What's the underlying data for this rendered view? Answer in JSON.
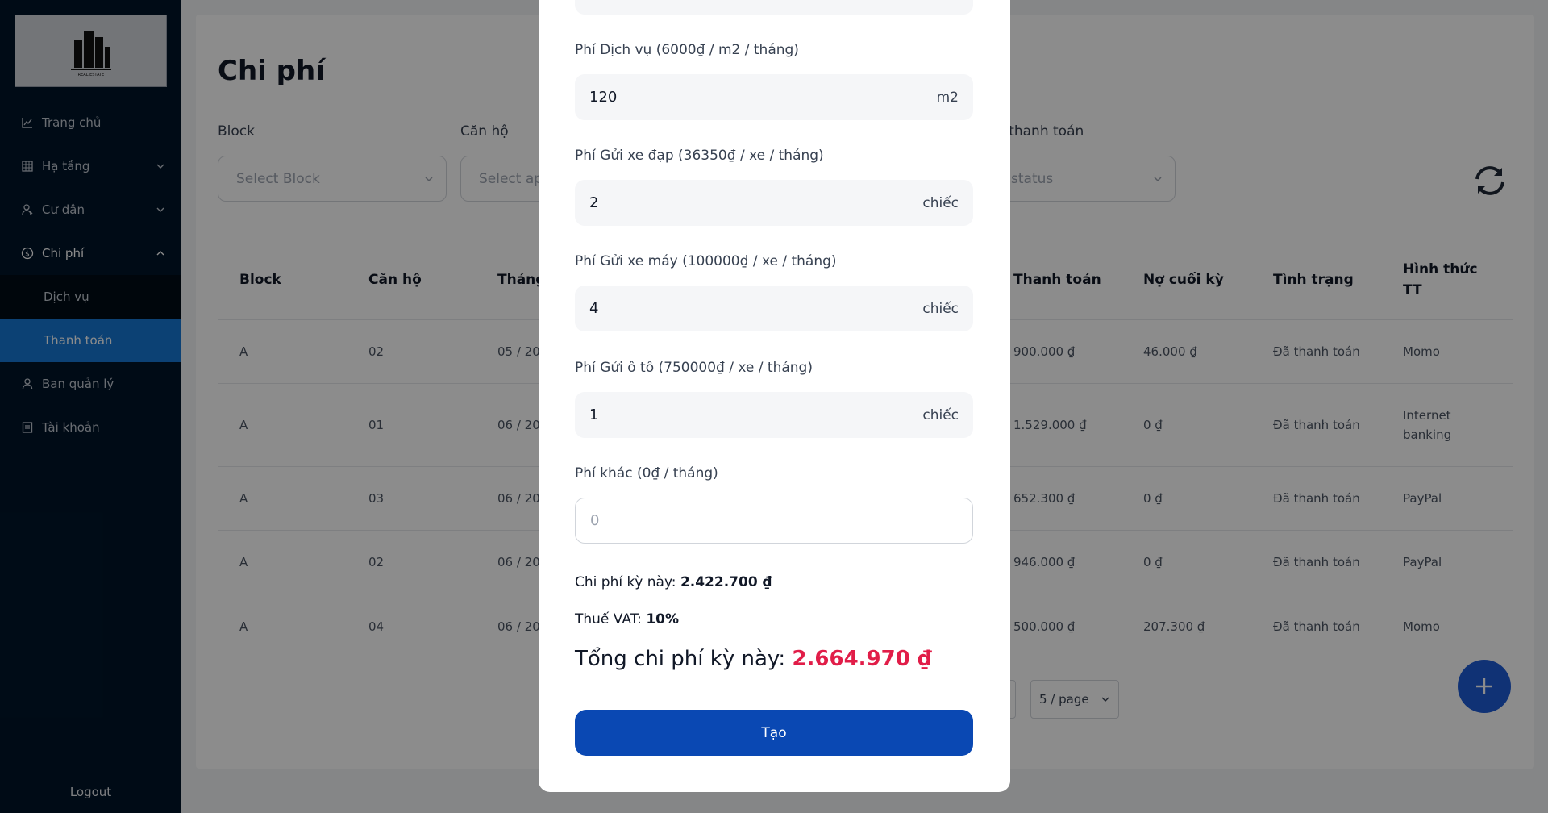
{
  "sidebar": {
    "logo_text": "REAL ESTATE",
    "items": [
      {
        "label": "Trang chủ",
        "icon": "line-chart-icon"
      },
      {
        "label": "Hạ tầng",
        "icon": "building-grid-icon"
      },
      {
        "label": "Cư dân",
        "icon": "team-icon"
      },
      {
        "label": "Chi phí",
        "icon": "dollar-circle-icon"
      },
      {
        "label": "Dịch vụ"
      },
      {
        "label": "Thanh toán"
      },
      {
        "label": "Ban quản lý",
        "icon": "user-icon"
      },
      {
        "label": "Tài khoản",
        "icon": "account-book-icon"
      }
    ],
    "logout": "Logout"
  },
  "page": {
    "title": "Chi phí",
    "filters": {
      "block_label": "Block",
      "block_placeholder": "Select Block",
      "apartment_label": "Căn hộ",
      "apartment_placeholder": "Select ap",
      "status_label": "g thanh toán",
      "status_placeholder": "status"
    }
  },
  "table": {
    "headers": [
      "Block",
      "Căn hộ",
      "Tháng",
      "Thanh toán",
      "Nợ cuối kỳ",
      "Tình trạng",
      "Hình thức TT"
    ],
    "rows": [
      {
        "block": "A",
        "apt": "02",
        "month": "05 / 20",
        "paid": "900.000 ₫",
        "debt": "46.000 ₫",
        "status": "Đã thanh toán",
        "method": "Momo"
      },
      {
        "block": "A",
        "apt": "01",
        "month": "06 / 20",
        "paid": "1.529.000 ₫",
        "debt": "0 ₫",
        "status": "Đã thanh toán",
        "method": "Internet banking"
      },
      {
        "block": "A",
        "apt": "03",
        "month": "06 / 20",
        "paid": "652.300 ₫",
        "debt": "0 ₫",
        "status": "Đã thanh toán",
        "method": "PayPal"
      },
      {
        "block": "A",
        "apt": "02",
        "month": "06 / 20",
        "paid": "946.000 ₫",
        "debt": "0 ₫",
        "status": "Đã thanh toán",
        "method": "PayPal"
      },
      {
        "block": "A",
        "apt": "04",
        "month": "06 / 20",
        "paid": "500.000 ₫",
        "debt": "207.300 ₫",
        "status": "Đã thanh toán",
        "method": "Momo"
      }
    ],
    "page_size": "5 / page"
  },
  "modal": {
    "service_label": "Phí Dịch vụ (6000₫ / m2 / tháng)",
    "service_value": "120",
    "service_unit": "m2",
    "bike_label": "Phí Gửi xe đạp (36350₫ / xe / tháng)",
    "bike_value": "2",
    "bike_unit": "chiếc",
    "moto_label": "Phí Gửi xe máy (100000₫ / xe / tháng)",
    "moto_value": "4",
    "moto_unit": "chiếc",
    "car_label": "Phí Gửi ô tô (750000₫ / xe / tháng)",
    "car_value": "1",
    "car_unit": "chiếc",
    "other_label": "Phí khác (0₫ / tháng)",
    "other_placeholder": "0",
    "period_cost_label": "Chi phí kỳ này:",
    "period_cost_value": "2.422.700 ₫",
    "vat_label": "Thuế VAT:",
    "vat_value": "10%",
    "total_label": "Tổng chi phí kỳ này:",
    "total_value": "2.664.970 ₫",
    "create_button": "Tạo"
  },
  "colors": {
    "sidebar_bg": "#001529",
    "active_item": "#1677d4",
    "primary_button": "#0a48b3",
    "total_red": "#e11d48"
  }
}
